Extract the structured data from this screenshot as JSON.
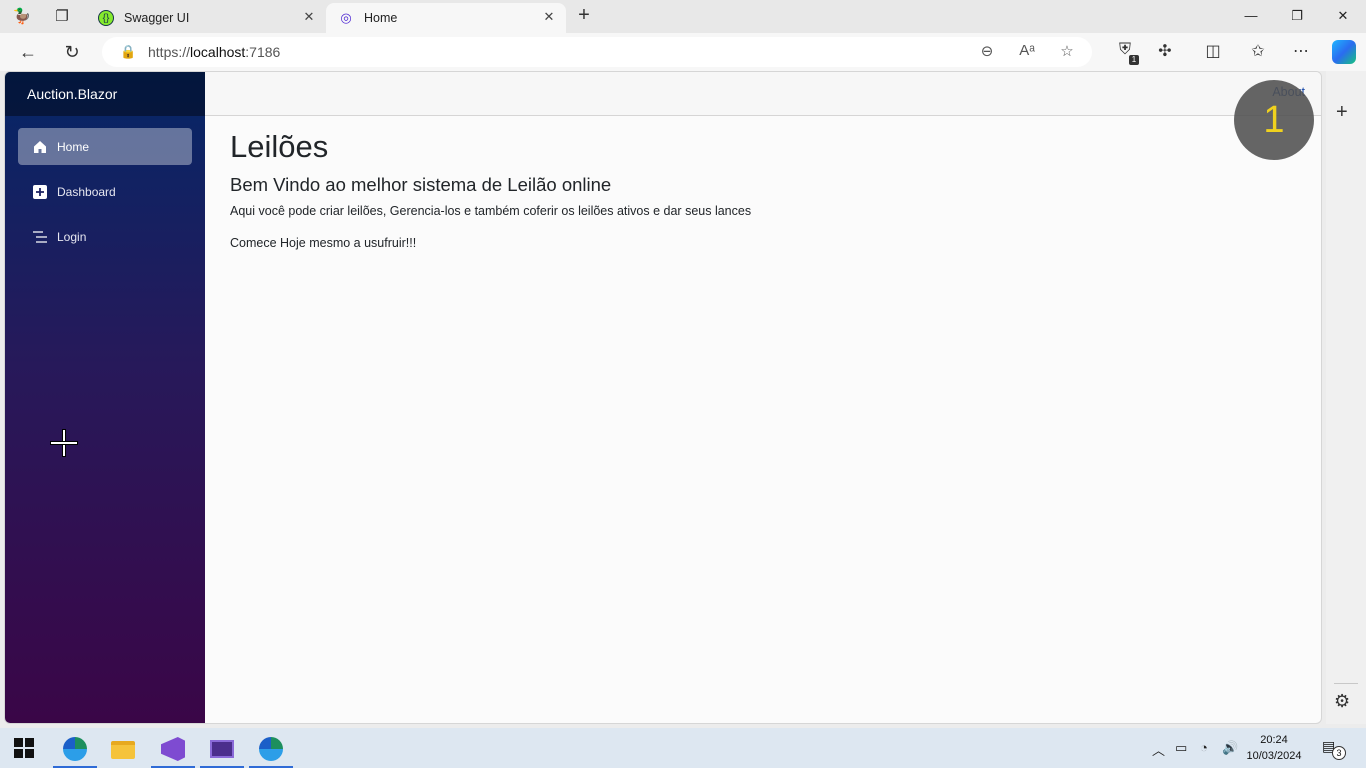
{
  "browser": {
    "tabs": [
      {
        "title": "Swagger UI",
        "icon": "swagger-icon",
        "active": false
      },
      {
        "title": "Home",
        "icon": "blazor-icon",
        "active": true
      }
    ],
    "url_prefix": "https://",
    "url_host": "localhost",
    "url_port": ":7186",
    "extension_badge": "1"
  },
  "app": {
    "brand": "Auction.Blazor",
    "nav": [
      {
        "label": "Home",
        "icon": "home-icon",
        "active": true
      },
      {
        "label": "Dashboard",
        "icon": "plus-square-icon",
        "active": false
      },
      {
        "label": "Login",
        "icon": "list-icon",
        "active": false
      }
    ],
    "top_link": "About",
    "click_indicator": "1",
    "heading": "Leilões",
    "subheading": "Bem Vindo ao melhor sistema de Leilão online",
    "paragraph1": "Aqui você pode criar leilões, Gerencia-los e também coferir os leilões ativos e dar seus lances",
    "paragraph2": "Comece Hoje mesmo a usufruir!!!"
  },
  "taskbar": {
    "time": "20:24",
    "date": "10/03/2024",
    "notification_count": "3"
  },
  "colors": {
    "sidebar_top": "#052767",
    "sidebar_bottom": "#3a0647",
    "link": "#1a4aa8",
    "indicator_text": "#f0d21e"
  }
}
